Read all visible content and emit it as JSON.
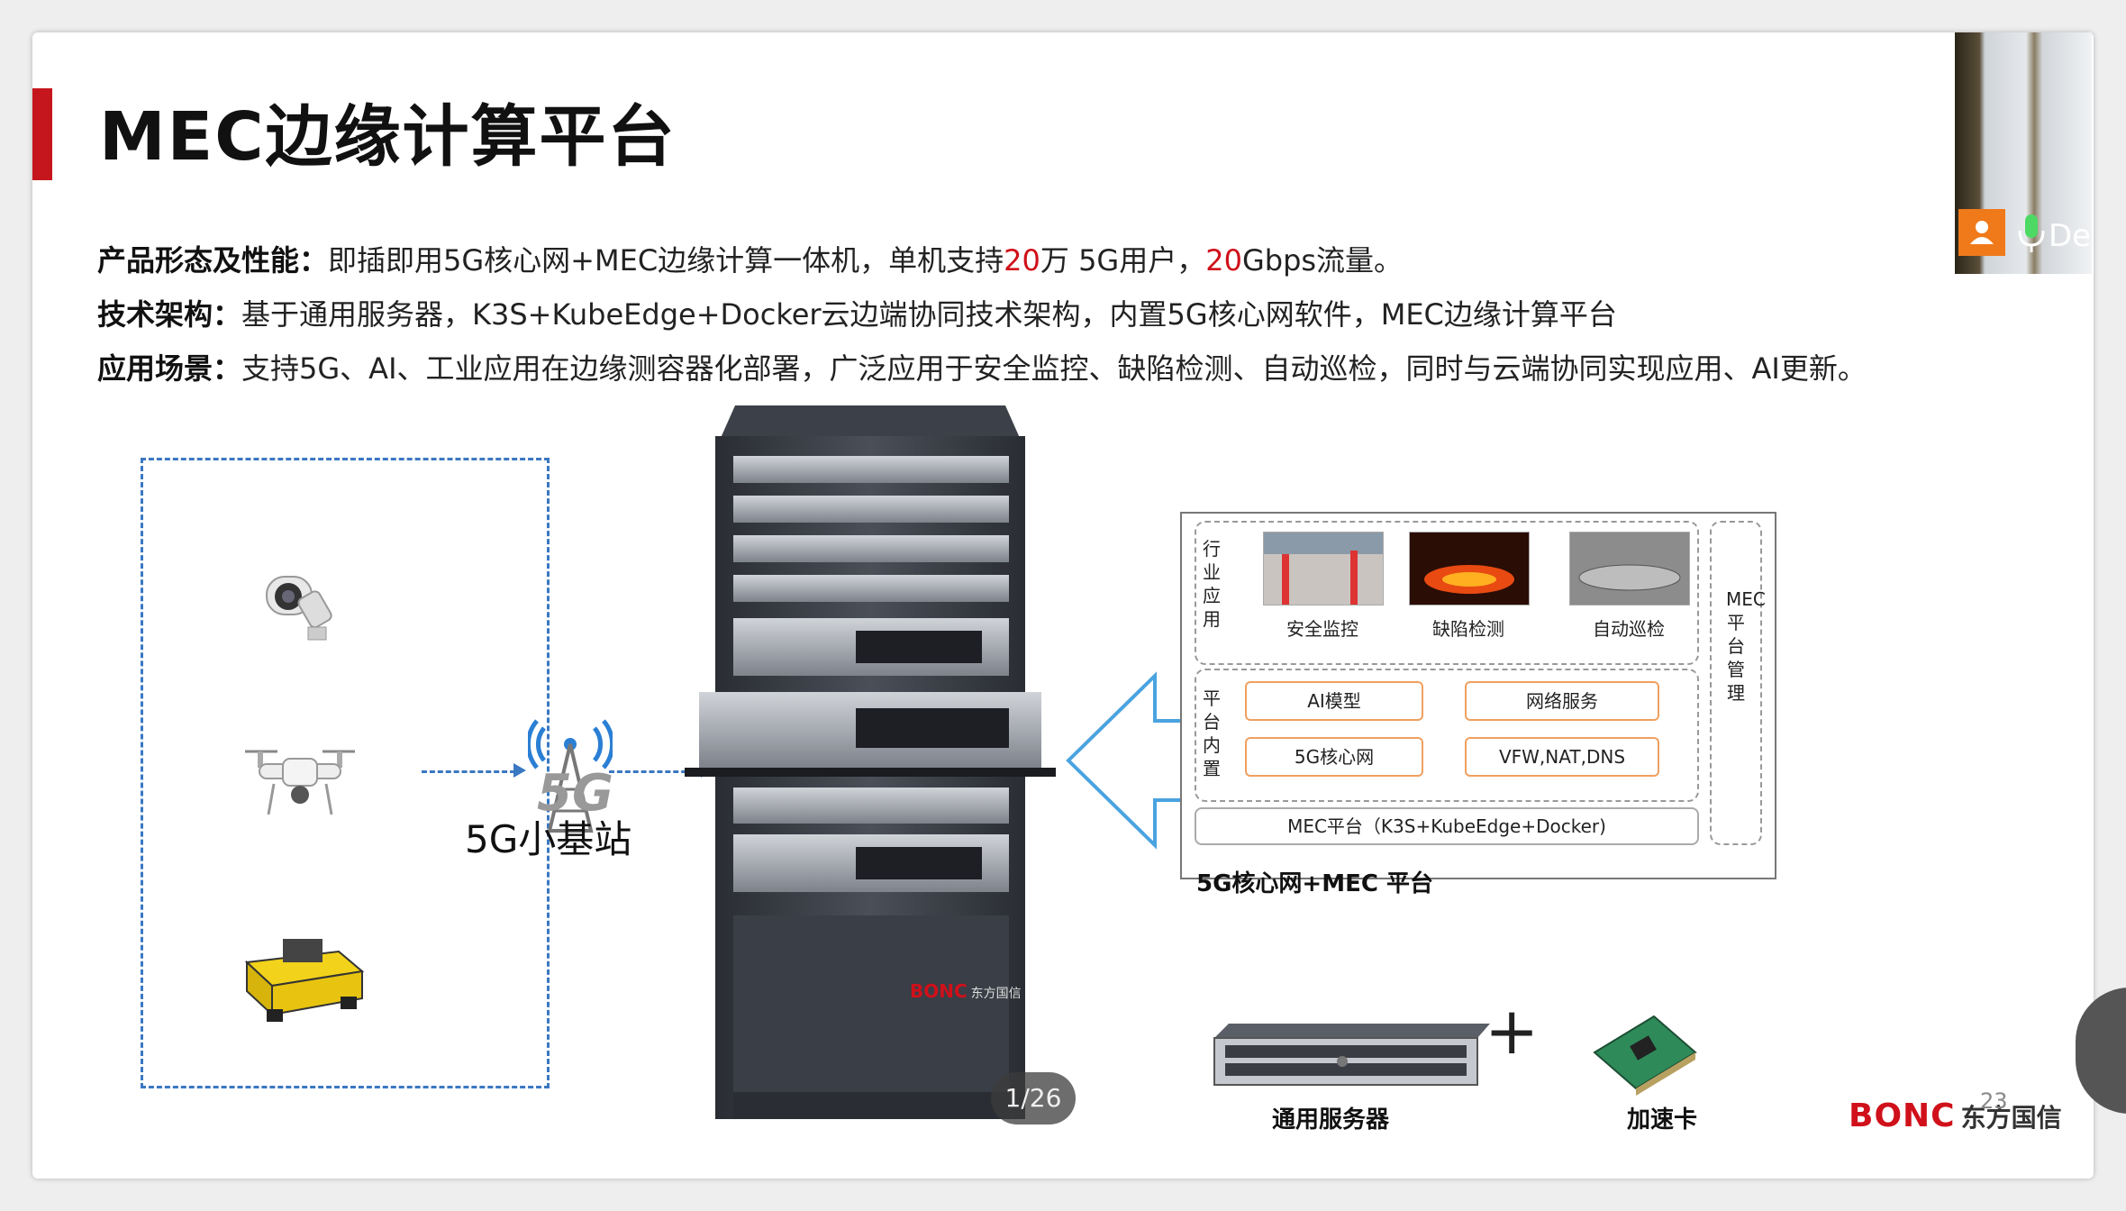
{
  "slide": {
    "title": "MEC边缘计算平台",
    "bullets": [
      {
        "label": "产品形态及性能：",
        "parts": [
          "即插即用5G核心网+MEC边缘计算一体机，单机支持",
          "20",
          "万 5G用户，",
          "20",
          "Gbps流量。"
        ]
      },
      {
        "label": "技术架构：",
        "text": "基于通用服务器，K3S+KubeEdge+Docker云边端协同技术架构，内置5G核心网软件，MEC边缘计算平台"
      },
      {
        "label": "应用场景：",
        "text": "支持5G、AI、工业应用在边缘测容器化部署，广泛应用于安全监控、缺陷检测、自动巡检，同时与云端协同实现应用、AI更新。"
      }
    ],
    "station": {
      "badge": "5G",
      "label": "5G小基站"
    },
    "devices": [
      "camera-icon",
      "drone-icon",
      "robot-vehicle-icon"
    ],
    "rack_brand": {
      "logo": "BONC",
      "cn": "东方国信"
    },
    "page_indicator": "1/26",
    "architecture": {
      "industry_label": "行业应用",
      "apps": [
        "安全监控",
        "缺陷检测",
        "自动巡检"
      ],
      "builtin_label": "平台内置",
      "builtin": [
        "AI模型",
        "网络服务",
        "5G核心网",
        "VFW,NAT,DNS"
      ],
      "platform": "MEC平台（K3S+KubeEdge+Docker)",
      "side_label": "MEC平台管理",
      "caption": "5G核心网+MEC 平台"
    },
    "hardware": {
      "server": "通用服务器",
      "plus": "+",
      "card": "加速卡"
    },
    "logo": {
      "bonc": "BONC",
      "cn": "东方国信"
    },
    "slide_number": "23"
  },
  "video": {
    "name": "De"
  },
  "colors": {
    "accent": "#c5161d",
    "highlight": "#d0101a",
    "dash": "#3a78c2",
    "box": "#f0a060"
  }
}
